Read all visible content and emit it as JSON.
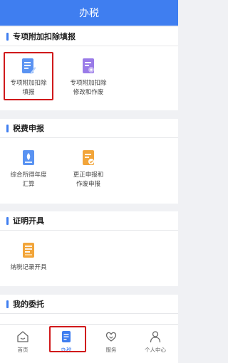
{
  "header": {
    "title": "办税"
  },
  "sections": [
    {
      "title": "专项附加扣除填报",
      "items": [
        {
          "label": "专项附加扣除\n填报",
          "icon": "document-edit-icon"
        },
        {
          "label": "专项附加扣除\n修改和作废",
          "icon": "document-settings-icon"
        }
      ]
    },
    {
      "title": "税费申报",
      "items": [
        {
          "label": "综合所得年度\n汇算",
          "icon": "tax-file-icon"
        },
        {
          "label": "更正申报和\n作废申报",
          "icon": "correction-file-icon"
        }
      ]
    },
    {
      "title": "证明开具",
      "items": [
        {
          "label": "纳税记录开具",
          "icon": "record-icon"
        }
      ]
    },
    {
      "title": "我的委托",
      "items": []
    }
  ],
  "tabbar": {
    "items": [
      {
        "label": "首页",
        "icon": "home-icon"
      },
      {
        "label": "办税",
        "icon": "tax-icon"
      },
      {
        "label": "服务",
        "icon": "service-icon"
      },
      {
        "label": "个人中心",
        "icon": "user-icon"
      }
    ],
    "active": "办税"
  },
  "colors": {
    "primary": "#3f7ef0",
    "highlight": "#d0191b",
    "icon_blue": "#5a93f2",
    "icon_purple": "#9a7be8",
    "icon_orange": "#f2a53a"
  }
}
